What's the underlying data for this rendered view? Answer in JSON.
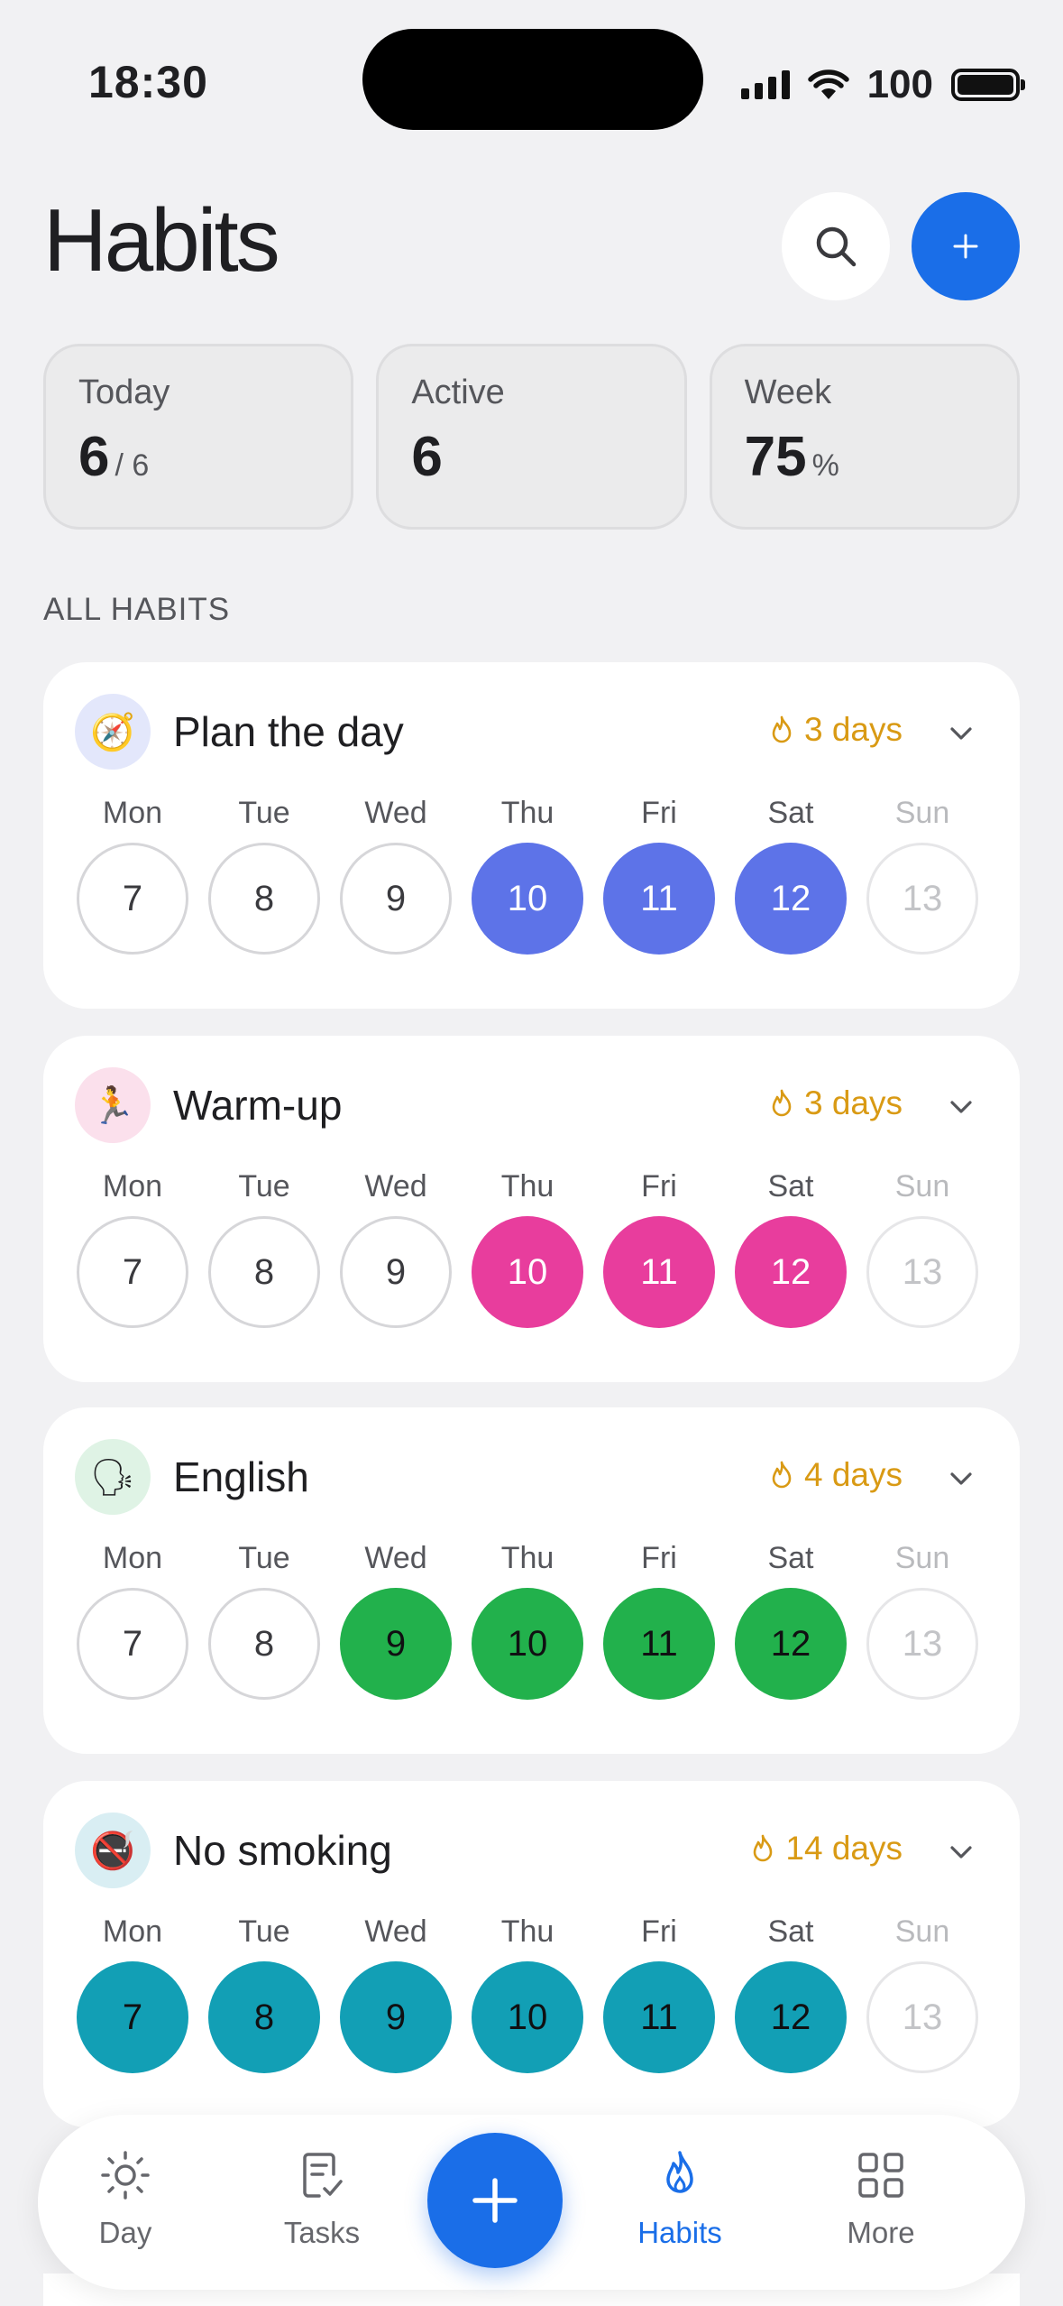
{
  "status": {
    "time": "18:30",
    "battery": "100"
  },
  "header": {
    "title": "Habits"
  },
  "stats": [
    {
      "label": "Today",
      "value": "6",
      "sub": "/ 6"
    },
    {
      "label": "Active",
      "value": "6",
      "sub": ""
    },
    {
      "label": "Week",
      "value": "75",
      "sub": "%"
    }
  ],
  "section_label": "ALL HABITS",
  "day_names": [
    "Mon",
    "Tue",
    "Wed",
    "Thu",
    "Fri",
    "Sat",
    "Sun"
  ],
  "day_numbers": [
    "7",
    "8",
    "9",
    "10",
    "11",
    "12",
    "13"
  ],
  "habits": [
    {
      "name": "Plan the day",
      "icon": "🧭",
      "icon_name": "compass-icon",
      "icon_bg": "#e3e7fb",
      "streak": "3 days",
      "color": "#5d73e8",
      "text_style": "light",
      "done": [
        false,
        false,
        false,
        true,
        true,
        true,
        false
      ]
    },
    {
      "name": "Warm-up",
      "icon": "🏃",
      "icon_name": "runner-icon",
      "icon_bg": "#fbe0ec",
      "streak": "3 days",
      "color": "#e83d9d",
      "text_style": "light",
      "done": [
        false,
        false,
        false,
        true,
        true,
        true,
        false
      ]
    },
    {
      "name": "English",
      "icon": "🗣",
      "icon_name": "speaking-head-icon",
      "icon_bg": "#dff3e5",
      "streak": "4 days",
      "color": "#22b14c",
      "text_style": "dark",
      "done": [
        false,
        false,
        true,
        true,
        true,
        true,
        false
      ]
    },
    {
      "name": "No smoking",
      "icon": "🚭",
      "icon_name": "no-smoking-icon",
      "icon_bg": "#d9eef3",
      "streak": "14 days",
      "color": "#129fb5",
      "text_style": "dark",
      "done": [
        true,
        true,
        true,
        true,
        true,
        true,
        false
      ]
    }
  ],
  "nav": {
    "day": "Day",
    "tasks": "Tasks",
    "habits": "Habits",
    "more": "More"
  },
  "colors": {
    "accent": "#1a6ee8",
    "streak": "#d99a14"
  }
}
